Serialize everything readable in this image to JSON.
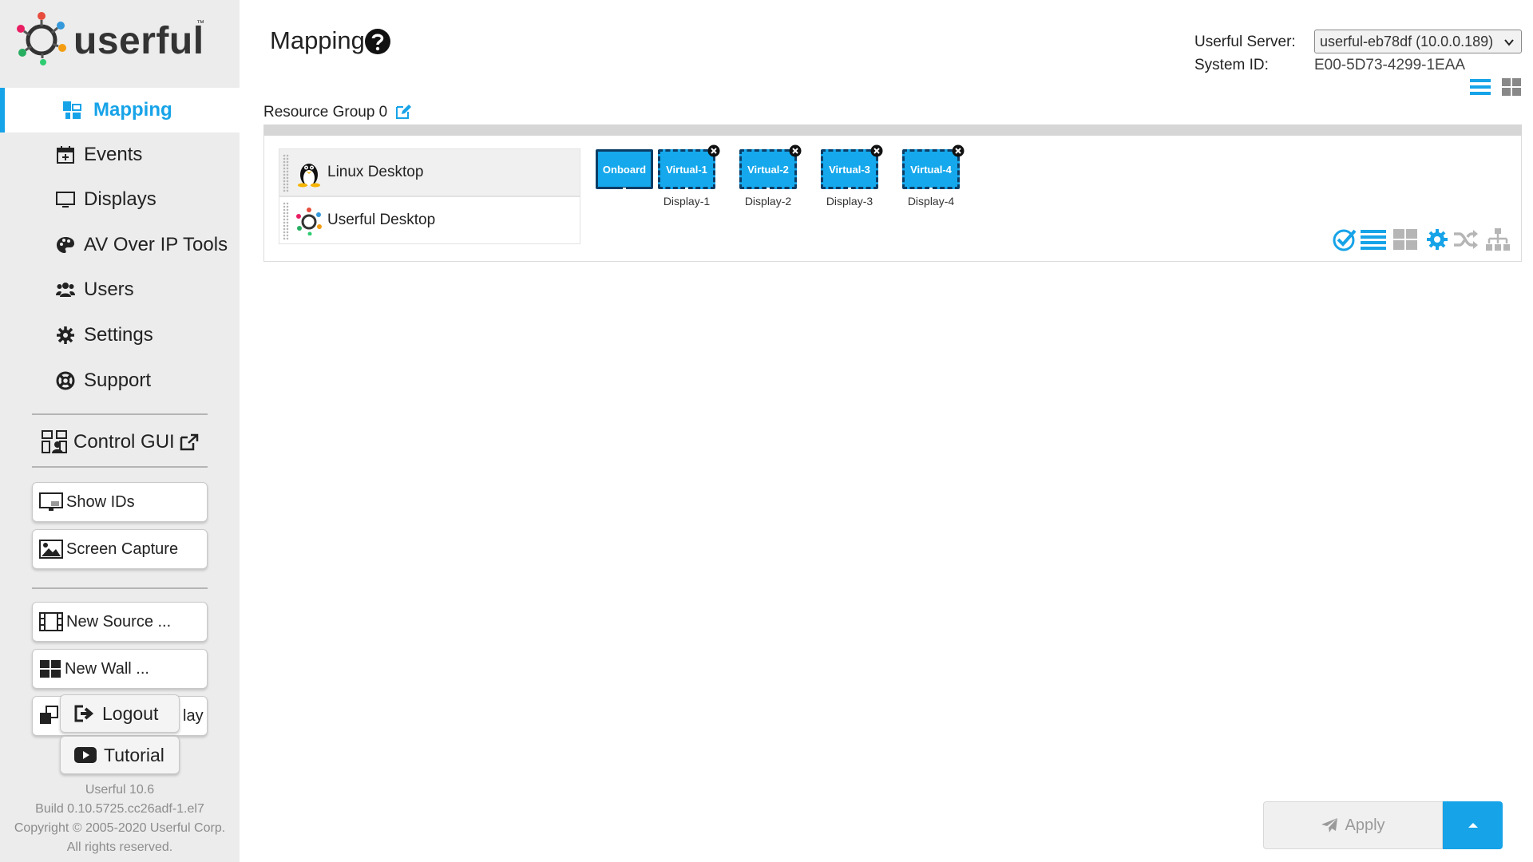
{
  "brand": {
    "name": "userful",
    "tm": "™"
  },
  "nav": {
    "items": [
      {
        "label": "Mapping",
        "icon": "mapping-icon",
        "active": true
      },
      {
        "label": "Events",
        "icon": "calendar-icon"
      },
      {
        "label": "Displays",
        "icon": "monitor-icon"
      },
      {
        "label": "AV Over IP Tools",
        "icon": "palette-icon"
      },
      {
        "label": "Users",
        "icon": "users-icon"
      },
      {
        "label": "Settings",
        "icon": "gear-icon"
      },
      {
        "label": "Support",
        "icon": "lifebuoy-icon"
      }
    ],
    "control_gui": "Control GUI"
  },
  "side_buttons": {
    "show_ids": "Show IDs",
    "screen_capture": "Screen Capture",
    "new_source": "New Source ...",
    "new_wall": "New Wall ...",
    "partial": "lay"
  },
  "floating": {
    "logout": "Logout",
    "tutorial": "Tutorial"
  },
  "footer": {
    "version": "Userful 10.6",
    "build": "Build 0.10.5725.cc26adf-1.el7",
    "copyright": "Copyright © 2005-2020 Userful Corp.",
    "rights": "All rights reserved."
  },
  "header": {
    "title": "Mapping",
    "server_label": "Userful Server:",
    "server_value": "userful-eb78df (10.0.0.189)",
    "system_id_label": "System ID:",
    "system_id_value": "E00-5D73-4299-1EAA"
  },
  "resource_group": {
    "label": "Resource Group 0",
    "sources": [
      {
        "label": "Linux Desktop",
        "icon": "linux-tux-icon"
      },
      {
        "label": "Userful Desktop",
        "icon": "userful-logo-icon"
      }
    ],
    "displays": [
      {
        "screen": "Onboard",
        "label": "",
        "removable": false
      },
      {
        "screen": "Virtual-1",
        "label": "Display-1",
        "removable": true
      },
      {
        "screen": "Virtual-2",
        "label": "Display-2",
        "removable": true
      },
      {
        "screen": "Virtual-3",
        "label": "Display-3",
        "removable": true
      },
      {
        "screen": "Virtual-4",
        "label": "Display-4",
        "removable": true
      }
    ]
  },
  "apply": {
    "label": "Apply"
  },
  "colors": {
    "accent": "#16a3e8",
    "display_fill": "#15a8ec",
    "display_border": "#0a3d66"
  }
}
